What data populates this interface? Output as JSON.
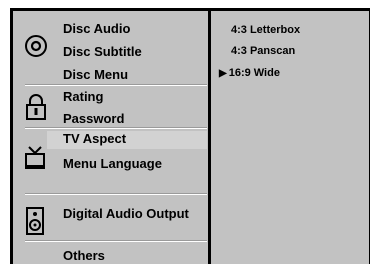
{
  "menu": {
    "items": [
      {
        "label": "Disc Audio"
      },
      {
        "label": "Disc Subtitle"
      },
      {
        "label": "Disc Menu"
      },
      {
        "label": "Rating"
      },
      {
        "label": "Password"
      },
      {
        "label": "TV Aspect",
        "selected": true
      },
      {
        "label": "Menu Language"
      },
      {
        "label": "Digital Audio Output"
      },
      {
        "label": "Others"
      }
    ],
    "icons": [
      "disc-icon",
      "lock-icon",
      "tv-icon",
      "speaker-icon"
    ]
  },
  "options": {
    "items": [
      {
        "label": "4:3 Letterbox"
      },
      {
        "label": "4:3 Panscan"
      },
      {
        "label": "16:9 Wide",
        "selected": true
      }
    ],
    "selected_marker": "▶"
  },
  "colors": {
    "panel": "#c2c2c2",
    "frame": "#000000",
    "highlight": "#d2d2d2",
    "text": "#000000"
  }
}
